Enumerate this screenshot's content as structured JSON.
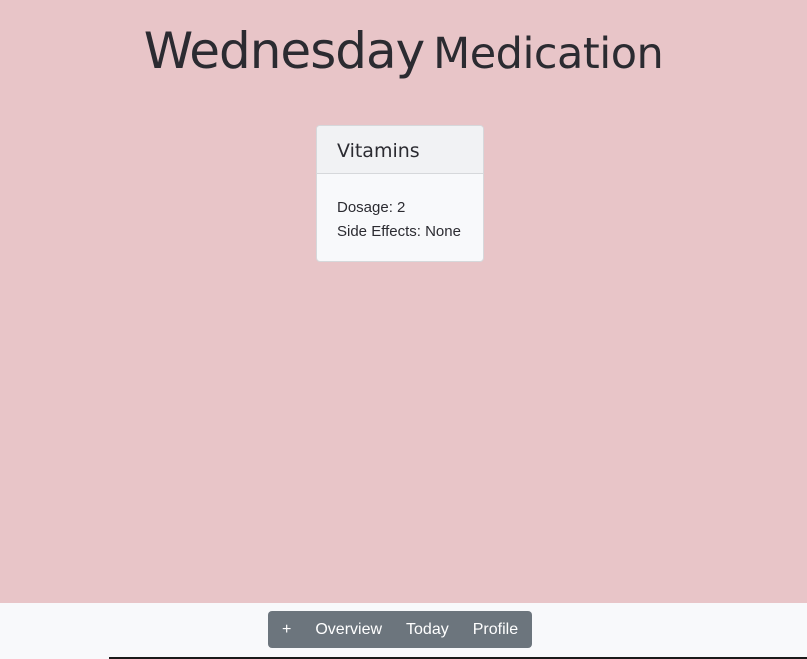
{
  "header": {
    "day": "Wednesday",
    "title_word": "Medication"
  },
  "medications": [
    {
      "name": "Vitamins",
      "dosage_label": "Dosage: 2",
      "side_effects_label": "Side Effects: None"
    }
  ],
  "nav": {
    "add_label": "+",
    "overview_label": "Overview",
    "today_label": "Today",
    "profile_label": "Profile"
  },
  "colors": {
    "background": "#e8c5c8",
    "nav_button": "#6c757d",
    "footer": "#f8f9fb"
  }
}
